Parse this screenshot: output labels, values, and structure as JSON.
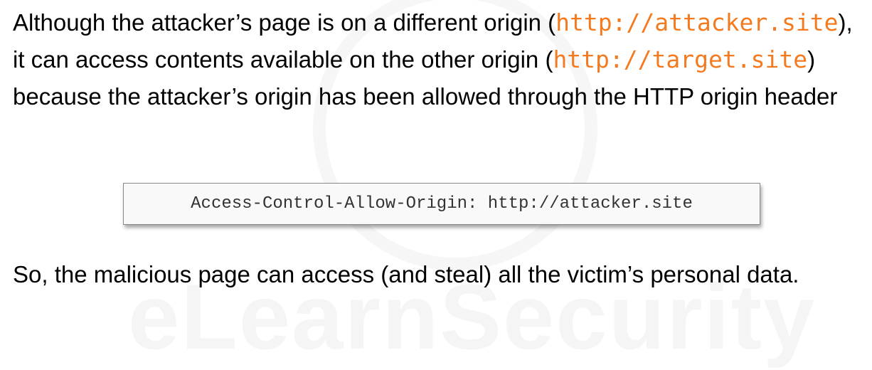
{
  "watermark": "eLearnSecurity",
  "paragraph1": {
    "t1": "Although the attacker’s page is on a different origin (",
    "code1": "http://attacker.site",
    "t2": "), it can access contents available on the other origin (",
    "code2": "http://target.site",
    "t3": ") because the attacker’s origin has been allowed through the HTTP origin header"
  },
  "code_box": "Access-Control-Allow-Origin: http://attacker.site",
  "paragraph2": "So, the malicious page can access (and steal) all the victim’s personal data.",
  "colors": {
    "accent": "#f47a20"
  }
}
